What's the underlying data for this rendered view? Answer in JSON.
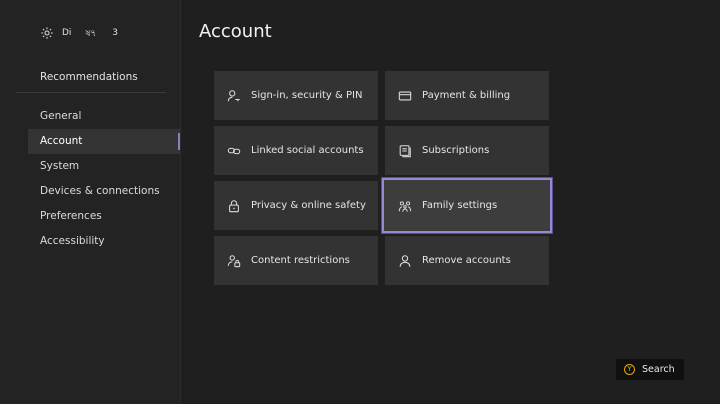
{
  "profile": {
    "name_part1": "Di",
    "name_part2": "ষ৭",
    "name_part3": "3"
  },
  "sidebar": {
    "top_item": "Recommendations",
    "items": [
      {
        "label": "General"
      },
      {
        "label": "Account",
        "active": true
      },
      {
        "label": "System"
      },
      {
        "label": "Devices & connections"
      },
      {
        "label": "Preferences"
      },
      {
        "label": "Accessibility"
      }
    ]
  },
  "page": {
    "title": "Account"
  },
  "tiles": [
    {
      "label": "Sign-in, security & PIN",
      "icon": "person-key-icon"
    },
    {
      "label": "Payment & billing",
      "icon": "credit-card-icon"
    },
    {
      "label": "Linked social accounts",
      "icon": "link-icon"
    },
    {
      "label": "Subscriptions",
      "icon": "subscription-icon"
    },
    {
      "label": "Privacy & online safety",
      "icon": "lock-icon"
    },
    {
      "label": "Family settings",
      "icon": "family-icon",
      "focused": true
    },
    {
      "label": "Content restrictions",
      "icon": "content-restriction-icon"
    },
    {
      "label": "Remove accounts",
      "icon": "person-icon"
    }
  ],
  "footer": {
    "search_label": "Search",
    "button_hint": "Y"
  },
  "colors": {
    "accent": "#9a86d8",
    "y_button": "#e0a800",
    "background": "#1f1f1f",
    "tile": "#333333"
  }
}
